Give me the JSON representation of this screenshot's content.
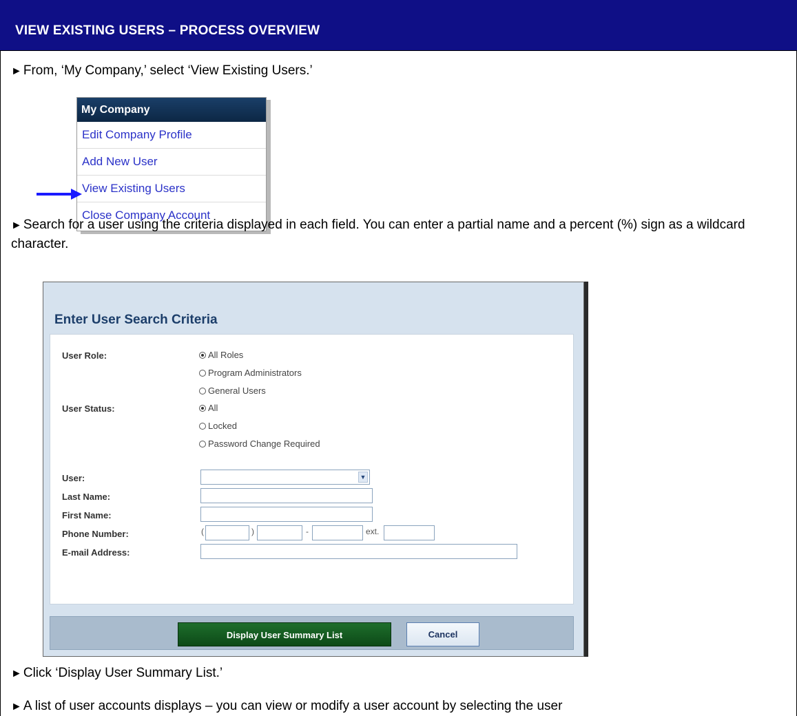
{
  "header": {
    "title": "VIEW EXISTING USERS – PROCESS OVERVIEW"
  },
  "steps": [
    "From, ‘My Company,’ select ‘View Existing Users.’",
    "Search for a user using the criteria displayed in each field. You can enter a partial name and a percent (%) sign as a wildcard character.",
    "Click ‘Display User Summary List.’",
    "A list of user accounts displays – you can view or modify a user account by selecting the user"
  ],
  "bullet_glyph": "►",
  "menu": {
    "title": "My Company",
    "items": [
      "Edit Company Profile",
      "Add New User",
      "View Existing Users",
      "Close Company Account"
    ],
    "highlighted_item": "View Existing Users",
    "arrow_color": "#1a1aff"
  },
  "search_form": {
    "title": "Enter User Search Criteria",
    "user_role": {
      "label": "User Role:",
      "options": [
        "All Roles",
        "Program Administrators",
        "General Users"
      ],
      "selected": "All Roles"
    },
    "user_status": {
      "label": "User Status:",
      "options": [
        "All",
        "Locked",
        "Password Change Required"
      ],
      "selected": "All"
    },
    "fields": {
      "user": {
        "label": "User:",
        "value": ""
      },
      "last_name": {
        "label": "Last Name:",
        "value": ""
      },
      "first_name": {
        "label": "First Name:",
        "value": ""
      },
      "phone": {
        "label": "Phone Number:",
        "open_paren": "(",
        "close_paren": ")",
        "dash": "-",
        "ext": "ext."
      },
      "email": {
        "label": "E-mail Address:",
        "value": ""
      }
    },
    "buttons": {
      "display": "Display User Summary List",
      "cancel": "Cancel"
    }
  },
  "colors": {
    "title_bar": "#0f0f86",
    "display_button": "#1e6e2c",
    "link": "#2b32c8"
  }
}
